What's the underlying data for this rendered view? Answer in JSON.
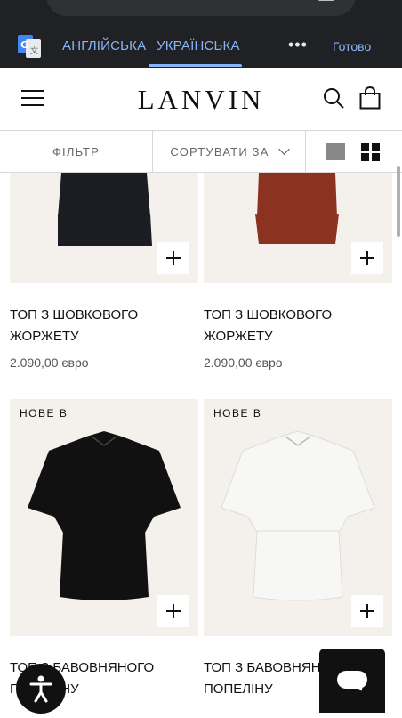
{
  "translate_bar": {
    "lang_source": "АНГЛІЙСЬКА",
    "lang_target": "УКРАЇНСЬКА",
    "more": "•••",
    "done": "Готово"
  },
  "header": {
    "logo": "LANVIN"
  },
  "toolbar": {
    "filter": "ФІЛЬТР",
    "sort": "СОРТУВАТИ ЗА"
  },
  "products": [
    {
      "badge": "",
      "name": "ТОП З ШОВКОВОГО ЖОРЖЕТУ",
      "price": "2.090,00 євро",
      "color": "#1b1d22"
    },
    {
      "badge": "",
      "name": "ТОП З ШОВКОВОГО ЖОРЖЕТУ",
      "price": "2.090,00 євро",
      "color": "#8b3220"
    },
    {
      "badge": "НОВЕ В",
      "name": "ТОП З БАВОВНЯНОГО ПОПЕЛІНУ",
      "price": "",
      "color": "#111111"
    },
    {
      "badge": "НОВЕ В",
      "name": "ТОП З БАВОВНЯНОГО ПОПЕЛІНУ",
      "price": "",
      "color": "#f7f7f5"
    }
  ],
  "colors": {
    "translate_bg": "#202124",
    "translate_accent": "#8ab4f8",
    "image_bg": "#f4f1ec"
  }
}
